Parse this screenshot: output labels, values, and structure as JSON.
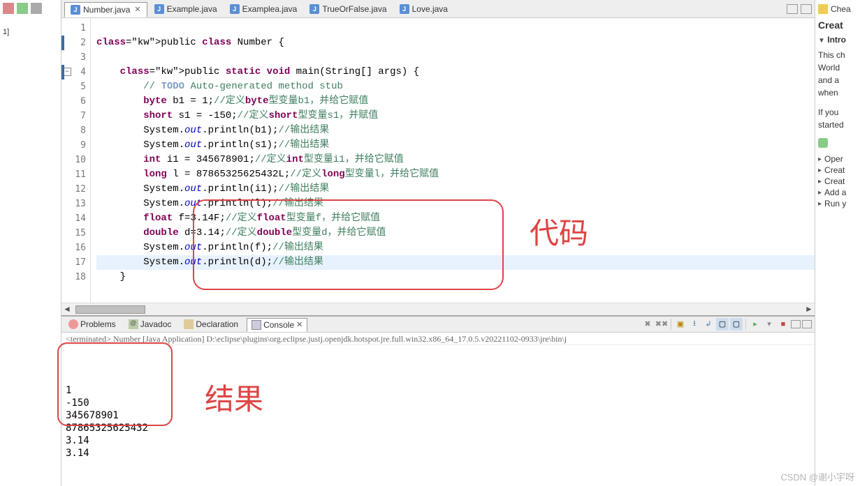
{
  "left_panel": {
    "tree_item": "1]"
  },
  "tabs": [
    {
      "label": "Number.java",
      "active": true,
      "closable": true
    },
    {
      "label": "Example.java",
      "active": false
    },
    {
      "label": "Examplea.java",
      "active": false
    },
    {
      "label": "TrueOrFalse.java",
      "active": false
    },
    {
      "label": "Love.java",
      "active": false
    }
  ],
  "code": {
    "lines": [
      {
        "n": 1,
        "t": ""
      },
      {
        "n": 2,
        "t": "public class Number {",
        "kw": [
          "public",
          "class"
        ]
      },
      {
        "n": 3,
        "t": ""
      },
      {
        "n": 4,
        "t": "    public static void main(String[] args) {",
        "fold": true,
        "kw": [
          "public",
          "static",
          "void"
        ]
      },
      {
        "n": 5,
        "t": "        // TODO Auto-generated method stub",
        "todo": true
      },
      {
        "n": 6,
        "t": "        byte b1 = 1;//定义byte型变量b1，并给它赋值",
        "kw": [
          "byte"
        ]
      },
      {
        "n": 7,
        "t": "        short s1 = -150;//定义short型变量s1，并赋值",
        "kw": [
          "short"
        ]
      },
      {
        "n": 8,
        "t": "        System.out.println(b1);//输出结果"
      },
      {
        "n": 9,
        "t": "        System.out.println(s1);//输出结果"
      },
      {
        "n": 10,
        "t": "        int i1 = 345678901;//定义int型变量i1，并给它赋值",
        "kw": [
          "int"
        ]
      },
      {
        "n": 11,
        "t": "        long l = 87865325625432L;//定义long型变量l，并给它赋值",
        "kw": [
          "long"
        ]
      },
      {
        "n": 12,
        "t": "        System.out.println(i1);//输出结果"
      },
      {
        "n": 13,
        "t": "        System.out.println(l);//输出结果"
      },
      {
        "n": 14,
        "t": "        float f=3.14F;//定义float型变量f，并给它赋值",
        "kw": [
          "float"
        ]
      },
      {
        "n": 15,
        "t": "        double d=3.14;//定义double型变量d，并给它赋值",
        "kw": [
          "double"
        ]
      },
      {
        "n": 16,
        "t": "        System.out.println(f);//输出结果"
      },
      {
        "n": 17,
        "t": "        System.out.println(d);//输出结果",
        "hl": true
      },
      {
        "n": 18,
        "t": "    }"
      }
    ]
  },
  "views": [
    {
      "label": "Problems",
      "icon": "problems-icon"
    },
    {
      "label": "Javadoc",
      "icon": "javadoc-icon"
    },
    {
      "label": "Declaration",
      "icon": "declaration-icon"
    },
    {
      "label": "Console",
      "icon": "console-icon",
      "active": true,
      "closable": true
    }
  ],
  "console": {
    "terminated": "<terminated> Number [Java Application] D:\\eclipse\\plugins\\org.eclipse.justj.openjdk.hotspot.jre.full.win32.x86_64_17.0.5.v20221102-0933\\jre\\bin\\j",
    "output": [
      "1",
      "-150",
      "345678901",
      "87865325625432",
      "3.14",
      "3.14"
    ]
  },
  "cheat": {
    "tab": "Chea",
    "title": "Creat",
    "intro": "Intro",
    "body1": "This ch\nWorld\nand a\nwhen",
    "body2": "If you\nstarted",
    "links": [
      "Oper",
      "Creat",
      "Creat",
      "Add a",
      "Run y"
    ]
  },
  "annotations": {
    "code_label": "代码",
    "result_label": "结果"
  },
  "watermark": "CSDN @谢小宇呀"
}
